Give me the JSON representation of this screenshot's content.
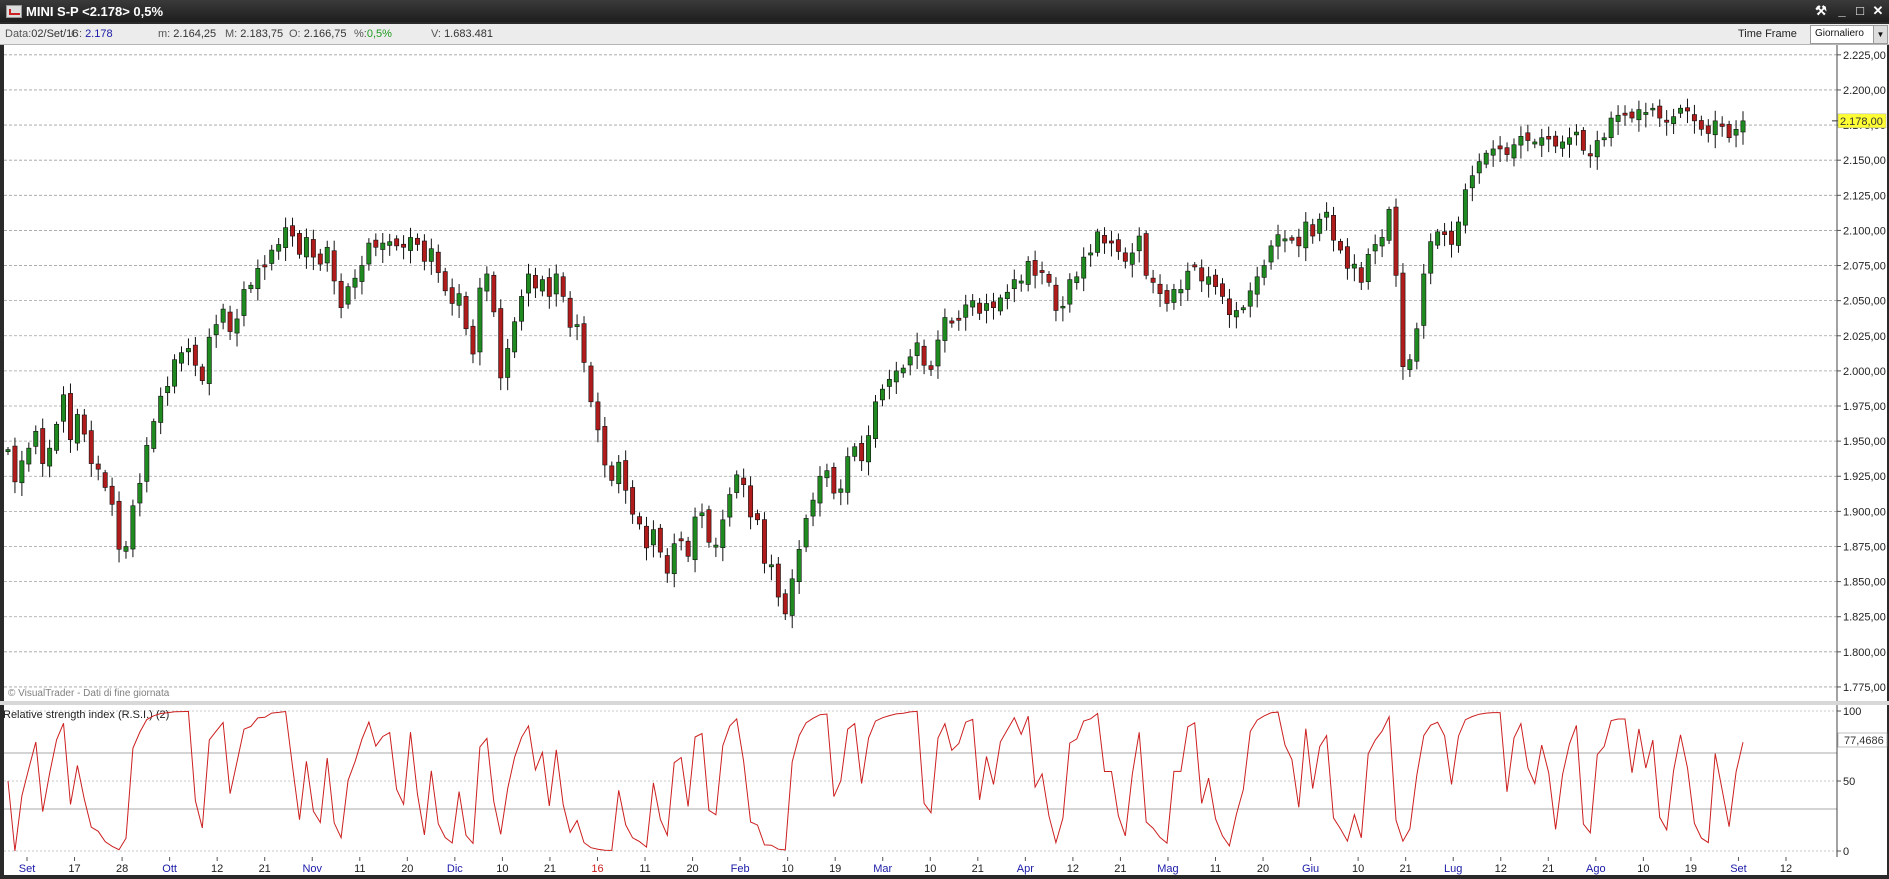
{
  "window": {
    "title": "MINI S-P <2.178> 0,5%",
    "buttons": [
      "⚒",
      "_",
      "□",
      "✕"
    ]
  },
  "infobar": {
    "date_label": "Data:",
    "date": "02/Set/16",
    "c_label": "C:",
    "c": "2.178",
    "m_label": "m:",
    "m": "2.164,25",
    "M_label": "M:",
    "M": "2.183,75",
    "o_label": "O:",
    "o": "2.166,75",
    "pct_label": "%:",
    "pct": "0,5%",
    "v_label": "V:",
    "v": "1.683.481",
    "timeframe_label": "Time Frame",
    "timeframe_value": "Giornaliero"
  },
  "colors": {
    "up": "#1f8a1f",
    "down": "#b01c1c",
    "rsi_line": "#cc1f1f",
    "price_label_bg": "#ffff33"
  },
  "chart_data": [
    {
      "type": "candlestick",
      "title": "MINI S-P",
      "ylim": [
        1765,
        2232
      ],
      "y_ticks": [
        "1.775,00",
        "1.800,00",
        "1.825,00",
        "1.850,00",
        "1.875,00",
        "1.900,00",
        "1.925,00",
        "1.950,00",
        "1.975,00",
        "2.000,00",
        "2.025,00",
        "2.050,00",
        "2.075,00",
        "2.100,00",
        "2.125,00",
        "2.150,00",
        "2.175,00",
        "2.200,00",
        "2.225,00"
      ],
      "last_price_label": "2.178,00",
      "last_price": 2178,
      "watermark": "© VisualTrader - Dati di fine giornata",
      "grid": true,
      "x_labels": [
        {
          "text": "Set",
          "month": true
        },
        {
          "text": "17",
          "month": false
        },
        {
          "text": "28",
          "month": false
        },
        {
          "text": "Ott",
          "month": true
        },
        {
          "text": "12",
          "month": false
        },
        {
          "text": "21",
          "month": false
        },
        {
          "text": "Nov",
          "month": true
        },
        {
          "text": "11",
          "month": false
        },
        {
          "text": "20",
          "month": false
        },
        {
          "text": "Dic",
          "month": true
        },
        {
          "text": "10",
          "month": false
        },
        {
          "text": "21",
          "month": false
        },
        {
          "text": "16",
          "year": true
        },
        {
          "text": "11",
          "month": false
        },
        {
          "text": "20",
          "month": false
        },
        {
          "text": "Feb",
          "month": true
        },
        {
          "text": "10",
          "month": false
        },
        {
          "text": "19",
          "month": false
        },
        {
          "text": "Mar",
          "month": true
        },
        {
          "text": "10",
          "month": false
        },
        {
          "text": "21",
          "month": false
        },
        {
          "text": "Apr",
          "month": true
        },
        {
          "text": "12",
          "month": false
        },
        {
          "text": "21",
          "month": false
        },
        {
          "text": "Mag",
          "month": true
        },
        {
          "text": "11",
          "month": false
        },
        {
          "text": "20",
          "month": false
        },
        {
          "text": "Giu",
          "month": true
        },
        {
          "text": "10",
          "month": false
        },
        {
          "text": "21",
          "month": false
        },
        {
          "text": "Lug",
          "month": true
        },
        {
          "text": "12",
          "month": false
        },
        {
          "text": "21",
          "month": false
        },
        {
          "text": "Ago",
          "month": true
        },
        {
          "text": "10",
          "month": false
        },
        {
          "text": "19",
          "month": false
        },
        {
          "text": "Set",
          "month": true
        },
        {
          "text": "12",
          "month": false
        }
      ],
      "closes": [
        1944,
        1921,
        1936,
        1945,
        1957,
        1934,
        1945,
        1962,
        1983,
        1951,
        1969,
        1955,
        1934,
        1930,
        1917,
        1905,
        1873,
        1875,
        1904,
        1920,
        1947,
        1964,
        1982,
        1989,
        2008,
        2013,
        2016,
        2004,
        1993,
        2024,
        2033,
        2044,
        2028,
        2037,
        2058,
        2061,
        2073,
        2074,
        2086,
        2090,
        2102,
        2096,
        2083,
        2095,
        2081,
        2076,
        2088,
        2064,
        2045,
        2060,
        2066,
        2075,
        2091,
        2088,
        2091,
        2092,
        2089,
        2088,
        2095,
        2090,
        2078,
        2087,
        2070,
        2057,
        2048,
        2055,
        2030,
        2012,
        2059,
        2069,
        2042,
        1995,
        2016,
        2035,
        2053,
        2069,
        2059,
        2065,
        2053,
        2069,
        2053,
        2031,
        2033,
        2006,
        1978,
        1958,
        1933,
        1922,
        1935,
        1915,
        1898,
        1891,
        1874,
        1887,
        1871,
        1856,
        1877,
        1879,
        1868,
        1896,
        1899,
        1878,
        1876,
        1894,
        1912,
        1926,
        1919,
        1896,
        1894,
        1863,
        1862,
        1839,
        1827,
        1852,
        1873,
        1895,
        1908,
        1925,
        1929,
        1913,
        1916,
        1939,
        1946,
        1936,
        1954,
        1978,
        1987,
        1994,
        2000,
        2002,
        2010,
        2020,
        2004,
        2001,
        2022,
        2038,
        2034,
        2036,
        2047,
        2050,
        2041,
        2048,
        2045,
        2052,
        2056,
        2065,
        2064,
        2078,
        2068,
        2070,
        2063,
        2043,
        2046,
        2065,
        2067,
        2081,
        2084,
        2099,
        2091,
        2091,
        2085,
        2078,
        2084,
        2096,
        2068,
        2063,
        2055,
        2048,
        2058,
        2058,
        2071,
        2074,
        2064,
        2067,
        2060,
        2053,
        2040,
        2043,
        2045,
        2057,
        2067,
        2075,
        2089,
        2097,
        2094,
        2093,
        2089,
        2106,
        2096,
        2108,
        2113,
        2093,
        2086,
        2073,
        2076,
        2063,
        2083,
        2090,
        2095,
        2115,
        2068,
        2003,
        2008,
        2030,
        2069,
        2092,
        2099,
        2097,
        2090,
        2106,
        2129,
        2139,
        2149,
        2155,
        2158,
        2158,
        2154,
        2161,
        2167,
        2164,
        2163,
        2166,
        2165,
        2160,
        2163,
        2166,
        2170,
        2157,
        2153,
        2164,
        2166,
        2180,
        2182,
        2182,
        2180,
        2186,
        2184,
        2187,
        2180,
        2177,
        2181,
        2187,
        2185,
        2178,
        2172,
        2169,
        2178,
        2174,
        2166,
        2172,
        2178
      ]
    },
    {
      "type": "line",
      "title": "Relative strength index (R.S.I.) (2)",
      "ylim": [
        0,
        100
      ],
      "y_ticks": [
        "100",
        "50",
        "0"
      ],
      "levels": [
        70,
        30
      ],
      "last_value_label": "77,4686",
      "grid": false
    }
  ]
}
